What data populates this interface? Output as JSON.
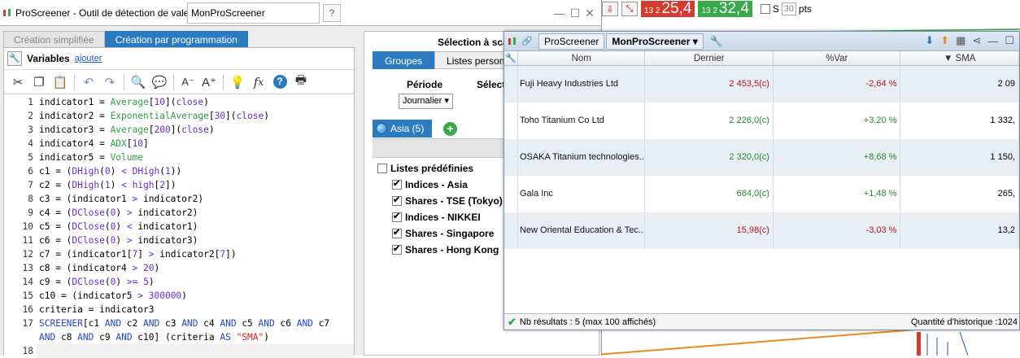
{
  "main_window": {
    "title": "ProScreener - Outil de détection de valeurs",
    "name_value": "MonProScreener",
    "tabs": [
      "Création simplifiée",
      "Création par programmation"
    ],
    "variables_label": "Variables",
    "add_link": "ajouter"
  },
  "code_lines": [
    {
      "n": "1",
      "html": "indicator1 = <span class=\"kw-fn\">Average</span>[<span class=\"kw-op\">10</span>](<span class=\"kw-op\">close</span>)"
    },
    {
      "n": "2",
      "html": "indicator2 = <span class=\"kw-fn\">ExponentialAverage</span>[<span class=\"kw-op\">30</span>](<span class=\"kw-op\">close</span>)"
    },
    {
      "n": "3",
      "html": "indicator3 = <span class=\"kw-fn\">Average</span>[<span class=\"kw-op\">200</span>](<span class=\"kw-op\">close</span>)"
    },
    {
      "n": "4",
      "html": "indicator4 = <span class=\"kw-fn\">ADX</span>[<span class=\"kw-op\">10</span>]"
    },
    {
      "n": "5",
      "html": "indicator5 = <span class=\"kw-fn\">Volume</span>"
    },
    {
      "n": "6",
      "html": "c1 = (<span class=\"kw-op\">DHigh</span>(<span class=\"kw-op\">0</span>) <span class=\"kw-op\">&lt;</span> <span class=\"kw-op\">DHigh</span>(<span class=\"kw-op\">1</span>))"
    },
    {
      "n": "7",
      "html": "c2 = (<span class=\"kw-op\">DHigh</span>(<span class=\"kw-op\">1</span>) <span class=\"kw-op\">&lt;</span> <span class=\"kw-op\">high</span>[<span class=\"kw-op\">2</span>])"
    },
    {
      "n": "8",
      "html": "c3 = (indicator1 <span class=\"kw-op\">&gt;</span> indicator2)"
    },
    {
      "n": "9",
      "html": "c4 = (<span class=\"kw-op\">DClose</span>(<span class=\"kw-op\">0</span>) <span class=\"kw-op\">&gt;</span> indicator2)"
    },
    {
      "n": "10",
      "html": "c5 = (<span class=\"kw-op\">DClose</span>(<span class=\"kw-op\">0</span>) <span class=\"kw-op\">&lt;</span> indicator1)"
    },
    {
      "n": "11",
      "html": "c6 = (<span class=\"kw-op\">DClose</span>(<span class=\"kw-op\">0</span>) <span class=\"kw-op\">&gt;</span> indicator3)"
    },
    {
      "n": "12",
      "html": "c7 = (indicator1[<span class=\"kw-op\">7</span>] <span class=\"kw-op\">&gt;</span> indicator2[<span class=\"kw-op\">7</span>])"
    },
    {
      "n": "13",
      "html": "c8 = (indicator4 <span class=\"kw-op\">&gt;</span> <span class=\"kw-op\">20</span>)"
    },
    {
      "n": "14",
      "html": "c9 = (<span class=\"kw-op\">DClose</span>(<span class=\"kw-op\">0</span>) <span class=\"kw-op\">&gt;=</span> <span class=\"kw-op\">5</span>)"
    },
    {
      "n": "15",
      "html": "c10 = (indicator5 <span class=\"kw-op\">&gt;</span> <span class=\"kw-op\">300000</span>)"
    },
    {
      "n": "16",
      "html": "criteria = indicator3"
    },
    {
      "n": "17",
      "html": "<span class=\"kw-bl\">SCREENER</span>[c1 <span class=\"kw-bl\">AND</span> c2 <span class=\"kw-bl\">AND</span> c3 <span class=\"kw-bl\">AND</span> c4 <span class=\"kw-bl\">AND</span> c5 <span class=\"kw-bl\">AND</span> c6 <span class=\"kw-bl\">AND</span> c7"
    },
    {
      "n": "",
      "html": "<span class=\"kw-bl\">AND</span> c8 <span class=\"kw-bl\">AND</span> c9 <span class=\"kw-bl\">AND</span> c10] (criteria <span class=\"kw-bl\">AS</span> <span class=\"kw-str\">\"SMA\"</span>)"
    },
    {
      "n": "18",
      "html": ""
    }
  ],
  "selection": {
    "title": "Sélection à sca",
    "tabs": [
      "Groupes",
      "Listes personne"
    ],
    "period_label": "Période",
    "select_label": "Sélect",
    "period_value": "Journalier",
    "asia_tab": "Asia (5)",
    "asia_header": "Asia",
    "tree": {
      "root": "Listes prédéfinies",
      "items": [
        "Indices - Asia",
        "Shares - TSE (Tokyo)",
        "Indices - NIKKEI",
        "Shares - Singapore",
        "Shares - Hong Kong"
      ]
    }
  },
  "results": {
    "ps_label": "ProScreener",
    "name": "MonProScreener",
    "columns": [
      "Nom",
      "Dernier",
      "%Var",
      "SMA"
    ],
    "rows": [
      {
        "name": "Fuji Heavy Industries Ltd",
        "last": "2 453,5(c)",
        "var": "-2,64 %",
        "sma": "2 09",
        "dir": "down"
      },
      {
        "name": "Toho Titanium Co Ltd",
        "last": "2 226,0(c)",
        "var": "+3,20 %",
        "sma": "1 332,",
        "dir": "up"
      },
      {
        "name": "OSAKA Titanium technologies...",
        "last": "2 320,0(c)",
        "var": "+8,68 %",
        "sma": "1 150,",
        "dir": "up"
      },
      {
        "name": "Gala Inc",
        "last": "684,0(c)",
        "var": "+1,48 %",
        "sma": "265,",
        "dir": "up"
      },
      {
        "name": "New Oriental Education & Tec...",
        "last": "15,98(c)",
        "var": "-3,03 %",
        "sma": "13,2",
        "dir": "down"
      }
    ],
    "status": "Nb résultats : 5 (max 100 affichés)",
    "history": "Quantité d'historique :1024"
  },
  "background": {
    "price_red_small": "13 2",
    "price_red_big": "25,4",
    "price_green_small": "13 2",
    "price_green_big": "32,4",
    "s_label": "S",
    "pts_value": "30",
    "pts_label": "pts"
  },
  "colors": {
    "accent": "#2b7bc1",
    "up": "#218a2c",
    "down": "#b11717"
  }
}
